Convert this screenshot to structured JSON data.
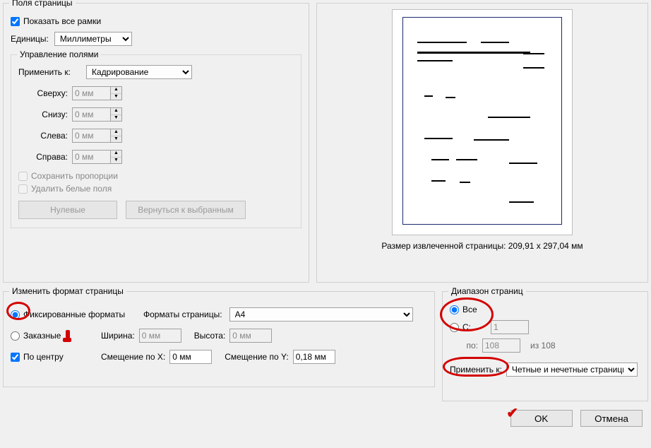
{
  "page_margins": {
    "legend": "Поля страницы",
    "show_all_frames": "Показать все рамки",
    "units_label": "Единицы:",
    "units_value": "Миллиметры",
    "manage": {
      "legend": "Управление полями",
      "apply_to_label": "Применить к:",
      "apply_to_value": "Кадрирование",
      "top": "Сверху:",
      "bottom": "Снизу:",
      "left": "Слева:",
      "right": "Справа:",
      "zero_val": "0 мм",
      "keep_ratio": "Сохранить пропорции",
      "remove_white": "Удалить белые поля",
      "btn_zero": "Нулевые",
      "btn_revert": "Вернуться к выбранным"
    },
    "preview_size_label": "Размер извлеченной страницы: 209,91 x 297,04 мм"
  },
  "resize": {
    "legend": "Изменить формат страницы",
    "fixed": "Фиксированные форматы",
    "custom": "Заказные",
    "center": "По центру",
    "page_formats_label": "Форматы страницы:",
    "page_format_value": "A4",
    "width_label": "Ширина:",
    "height_label": "Высота:",
    "zero_val": "0 мм",
    "offset_x_label": "Смещение по X:",
    "offset_x_value": "0 мм",
    "offset_y_label": "Смещение по Y:",
    "offset_y_value": "0,18 мм"
  },
  "range": {
    "legend": "Диапазон страниц",
    "all": "Все",
    "from_label": "С:",
    "from_value": "1",
    "to_label": "по:",
    "to_value": "108",
    "of_label": "из 108",
    "apply_label": "Применить к:",
    "apply_value": "Четные и нечетные страницы"
  },
  "buttons": {
    "ok": "OK",
    "cancel": "Отмена"
  }
}
